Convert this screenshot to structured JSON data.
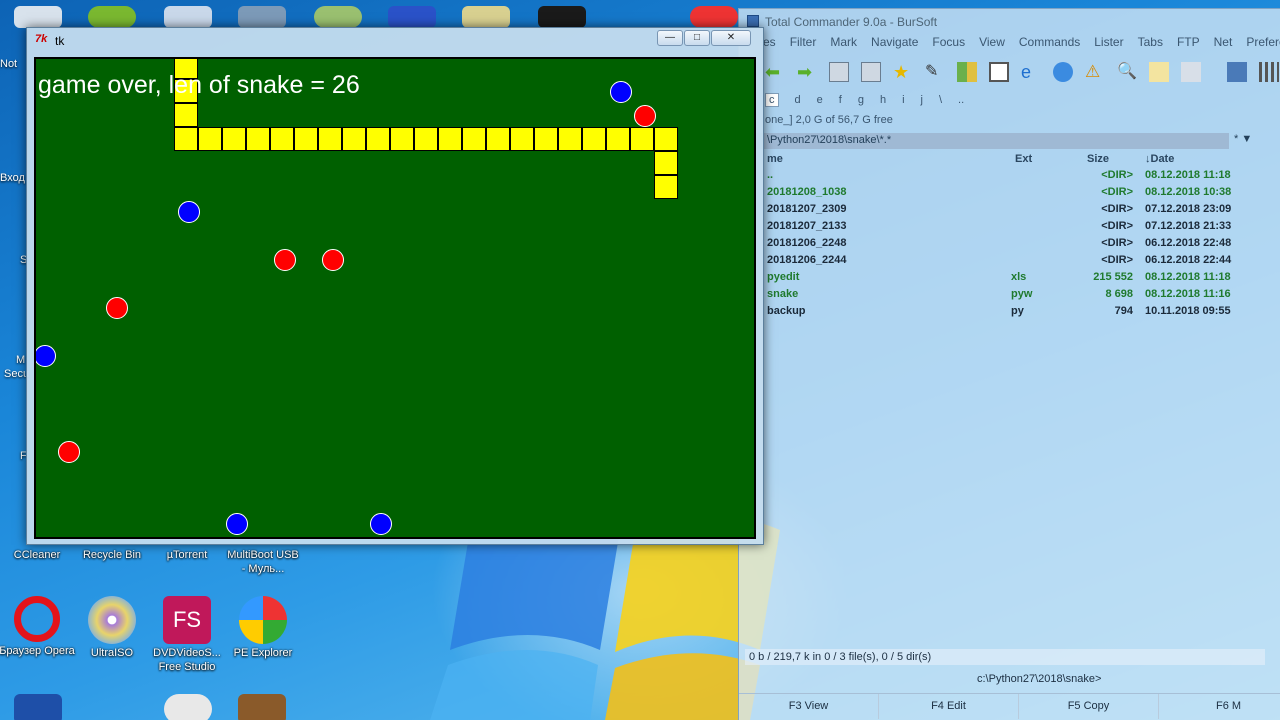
{
  "desktop": {
    "left_fragments": [
      "Not",
      "Вход",
      "S",
      "M",
      "Secu",
      "F"
    ],
    "icons": [
      {
        "label": "CCleaner",
        "icon": "ccleaner-icon"
      },
      {
        "label": "Recycle Bin",
        "icon": "recycle-bin-icon"
      },
      {
        "label": "µTorrent",
        "icon": "utorrent-icon"
      },
      {
        "label": "MultiBoot USB - Муль...",
        "icon": "multiboot-icon"
      },
      {
        "label": "Браузер Opera",
        "icon": "opera-icon"
      },
      {
        "label": "UltraISO",
        "icon": "ultraiso-icon"
      },
      {
        "label": "DVDVideoS... Free Studio",
        "icon": "freestudio-icon",
        "badge": "FS"
      },
      {
        "label": "PE Explorer",
        "icon": "pe-explorer-icon"
      }
    ]
  },
  "tc": {
    "title": "Total Commander 9.0a - BurSoft",
    "menu": [
      "es",
      "Filter",
      "Mark",
      "Navigate",
      "Focus",
      "View",
      "Commands",
      "Lister",
      "Tabs",
      "FTP",
      "Net",
      "Preferen"
    ],
    "drives": [
      "c",
      "d",
      "e",
      "f",
      "g",
      "h",
      "i",
      "j",
      "\\",
      ".."
    ],
    "free_info": "one_]  2,0 G of 56,7 G free",
    "path": "\\Python27\\2018\\snake\\*.*",
    "path_right": "* ▼",
    "columns": {
      "name": "me",
      "ext": "Ext",
      "size": "Size",
      "date": "↓Date"
    },
    "files": [
      {
        "name": "..",
        "ext": "",
        "size": "<DIR>",
        "date": "08.12.2018 11:18",
        "color": "#1f7a2e"
      },
      {
        "name": "20181208_1038",
        "ext": "",
        "size": "<DIR>",
        "date": "08.12.2018 10:38",
        "color": "#1f7a2e"
      },
      {
        "name": "20181207_2309",
        "ext": "",
        "size": "<DIR>",
        "date": "07.12.2018 23:09",
        "color": "#1b2a3a"
      },
      {
        "name": "20181207_2133",
        "ext": "",
        "size": "<DIR>",
        "date": "07.12.2018 21:33",
        "color": "#1b2a3a"
      },
      {
        "name": "20181206_2248",
        "ext": "",
        "size": "<DIR>",
        "date": "06.12.2018 22:48",
        "color": "#1b2a3a"
      },
      {
        "name": "20181206_2244",
        "ext": "",
        "size": "<DIR>",
        "date": "06.12.2018 22:44",
        "color": "#1b2a3a"
      },
      {
        "name": "pyedit",
        "ext": "xls",
        "size": "215 552",
        "date": "08.12.2018 11:18",
        "color": "#1f7a2e"
      },
      {
        "name": "snake",
        "ext": "pyw",
        "size": "8 698",
        "date": "08.12.2018 11:16",
        "color": "#1f7a2e"
      },
      {
        "name": "backup",
        "ext": "py",
        "size": "794",
        "date": "10.11.2018 09:55",
        "color": "#1b2a3a"
      }
    ],
    "status": "0 b / 219,7 k in 0 / 3 file(s), 0 / 5 dir(s)",
    "cmdline": "c:\\Python27\\2018\\snake>",
    "fkeys": [
      "F3 View",
      "F4 Edit",
      "F5 Copy",
      "F6 M"
    ]
  },
  "tk": {
    "title": "tk",
    "game_over": "game over, len of snake = 26",
    "colors": {
      "background": "#006000",
      "snake": "#ffff00",
      "red_fruit": "#ff0000",
      "blue_fruit": "#0000ff"
    },
    "grid_cell": 24,
    "snake_cells": [
      [
        6,
        0
      ],
      [
        6,
        1
      ],
      [
        6,
        2
      ],
      [
        6,
        3
      ],
      [
        7,
        3
      ],
      [
        8,
        3
      ],
      [
        9,
        3
      ],
      [
        10,
        3
      ],
      [
        11,
        3
      ],
      [
        12,
        3
      ],
      [
        13,
        3
      ],
      [
        14,
        3
      ],
      [
        15,
        3
      ],
      [
        16,
        3
      ],
      [
        17,
        3
      ],
      [
        18,
        3
      ],
      [
        19,
        3
      ],
      [
        20,
        3
      ],
      [
        21,
        3
      ],
      [
        22,
        3
      ],
      [
        23,
        3
      ],
      [
        24,
        3
      ],
      [
        25,
        3
      ],
      [
        26,
        3
      ],
      [
        26,
        4
      ],
      [
        26,
        5
      ]
    ],
    "fruits": [
      {
        "color": "blue",
        "cell": [
          24,
          1
        ]
      },
      {
        "color": "red",
        "cell": [
          25,
          2
        ]
      },
      {
        "color": "blue",
        "cell": [
          6,
          6
        ]
      },
      {
        "color": "red",
        "cell": [
          10,
          8
        ]
      },
      {
        "color": "red",
        "cell": [
          12,
          8
        ]
      },
      {
        "color": "red",
        "cell": [
          3,
          10
        ]
      },
      {
        "color": "blue",
        "cell": [
          0,
          12
        ]
      },
      {
        "color": "red",
        "cell": [
          1,
          16
        ]
      },
      {
        "color": "blue",
        "cell": [
          8,
          19
        ]
      },
      {
        "color": "blue",
        "cell": [
          14,
          19
        ]
      }
    ]
  }
}
